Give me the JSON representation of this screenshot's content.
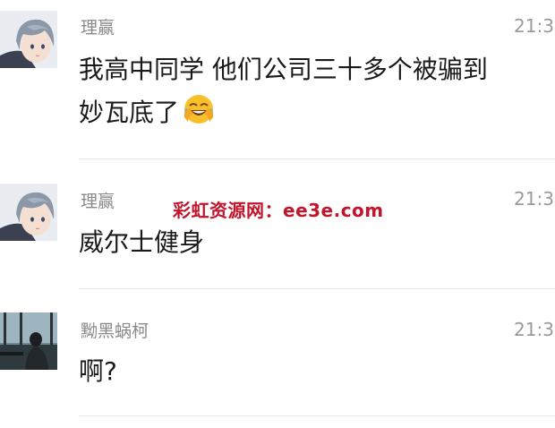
{
  "messages": [
    {
      "sender": "理赢",
      "time": "21:3",
      "lines": [
        "我高中同学 他们公司三十多个被骗到",
        "妙瓦底了"
      ],
      "avatar": "anime-boy-avatar",
      "emoji": "crying-laughing-emoji"
    },
    {
      "sender": "理赢",
      "time": "21:3",
      "lines": [
        "威尔士健身"
      ],
      "avatar": "anime-boy-avatar"
    },
    {
      "sender": "黝黑蜗柯",
      "time": "21:3",
      "lines": [
        "啊?"
      ],
      "avatar": "photo-avatar"
    }
  ],
  "watermark": "彩虹资源网：ee3e.com",
  "colors": {
    "watermark": "#c2142b",
    "name": "#8a8a8a",
    "time": "#9a9a9a",
    "text": "#1a1a1a",
    "divider": "#e8e8e8"
  }
}
